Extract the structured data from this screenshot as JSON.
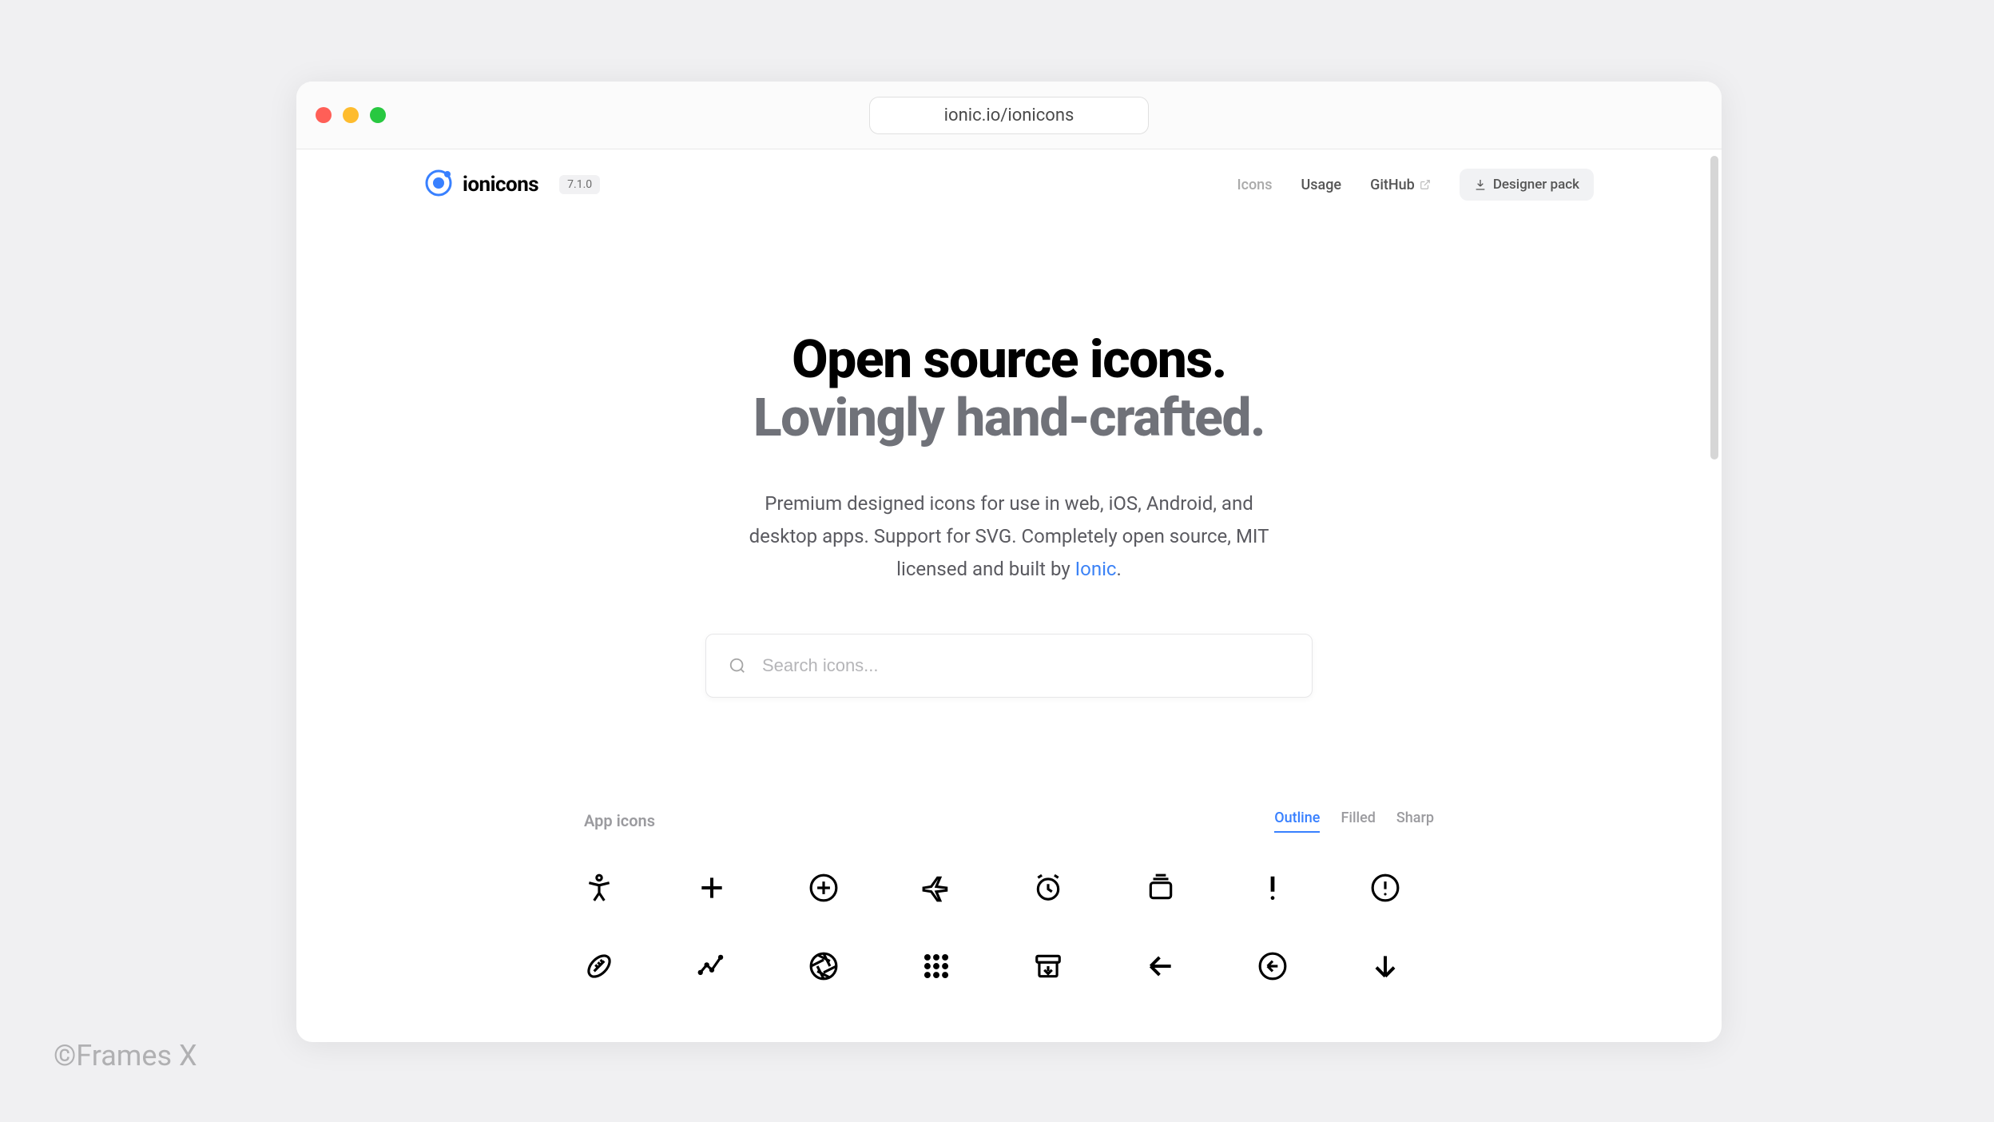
{
  "url": "ionic.io/ionicons",
  "brand": {
    "name": "ionicons",
    "version": "7.1.0"
  },
  "nav": {
    "icons": "Icons",
    "usage": "Usage",
    "github": "GitHub",
    "designer_pack": "Designer pack"
  },
  "hero": {
    "title_line1": "Open source icons.",
    "title_line2": "Lovingly hand-crafted.",
    "desc_part1": "Premium designed icons for use in web, iOS, Android, and desktop apps. Support for SVG. Completely open source, MIT licensed and built by ",
    "desc_link": "Ionic",
    "desc_part2": "."
  },
  "search": {
    "placeholder": "Search icons..."
  },
  "icons_section": {
    "label": "App icons",
    "tabs": {
      "outline": "Outline",
      "filled": "Filled",
      "sharp": "Sharp"
    },
    "icons": [
      "accessibility",
      "add",
      "add-circle",
      "airplane",
      "alarm",
      "albums",
      "alert",
      "alert-circle",
      "american-football",
      "analytics",
      "aperture",
      "apps",
      "archive",
      "arrow-back",
      "arrow-back-circle",
      "arrow-down"
    ]
  },
  "watermark": "©Frames X"
}
